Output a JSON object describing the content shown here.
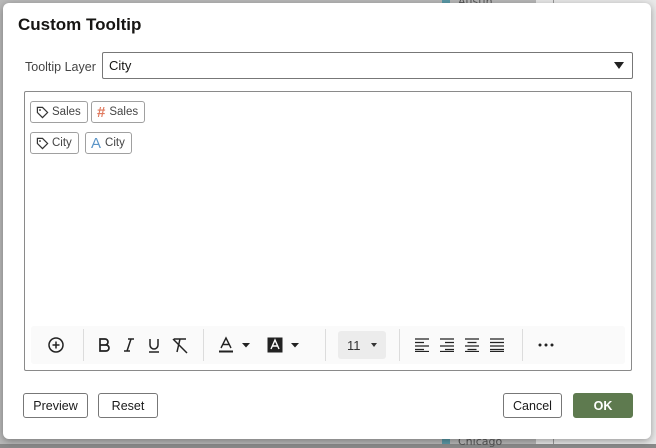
{
  "background": {
    "top_text": "Austin",
    "bottom_text": "Chicago"
  },
  "dialog": {
    "title": "Custom Tooltip",
    "tooltip_layer": {
      "label": "Tooltip Layer",
      "value": "City"
    },
    "editor": {
      "chips": [
        {
          "field": "Sales",
          "type_icon": "hash-icon",
          "type_value": "Sales"
        },
        {
          "field": "City",
          "type_icon": "text-a-icon",
          "type_value": "City"
        }
      ]
    },
    "toolbar": {
      "font_size": "11",
      "items": [
        "insert",
        "bold",
        "italic",
        "underline",
        "clear-format",
        "font-color",
        "highlight-color",
        "font-size",
        "align-left",
        "align-right",
        "align-center",
        "justify",
        "more"
      ]
    },
    "buttons": {
      "preview": "Preview",
      "reset": "Reset",
      "cancel": "Cancel",
      "ok": "OK"
    }
  },
  "colors": {
    "ok_button": "#5e7a4f",
    "hash_icon": "#e07a5f",
    "text_icon": "#5b95c8"
  }
}
